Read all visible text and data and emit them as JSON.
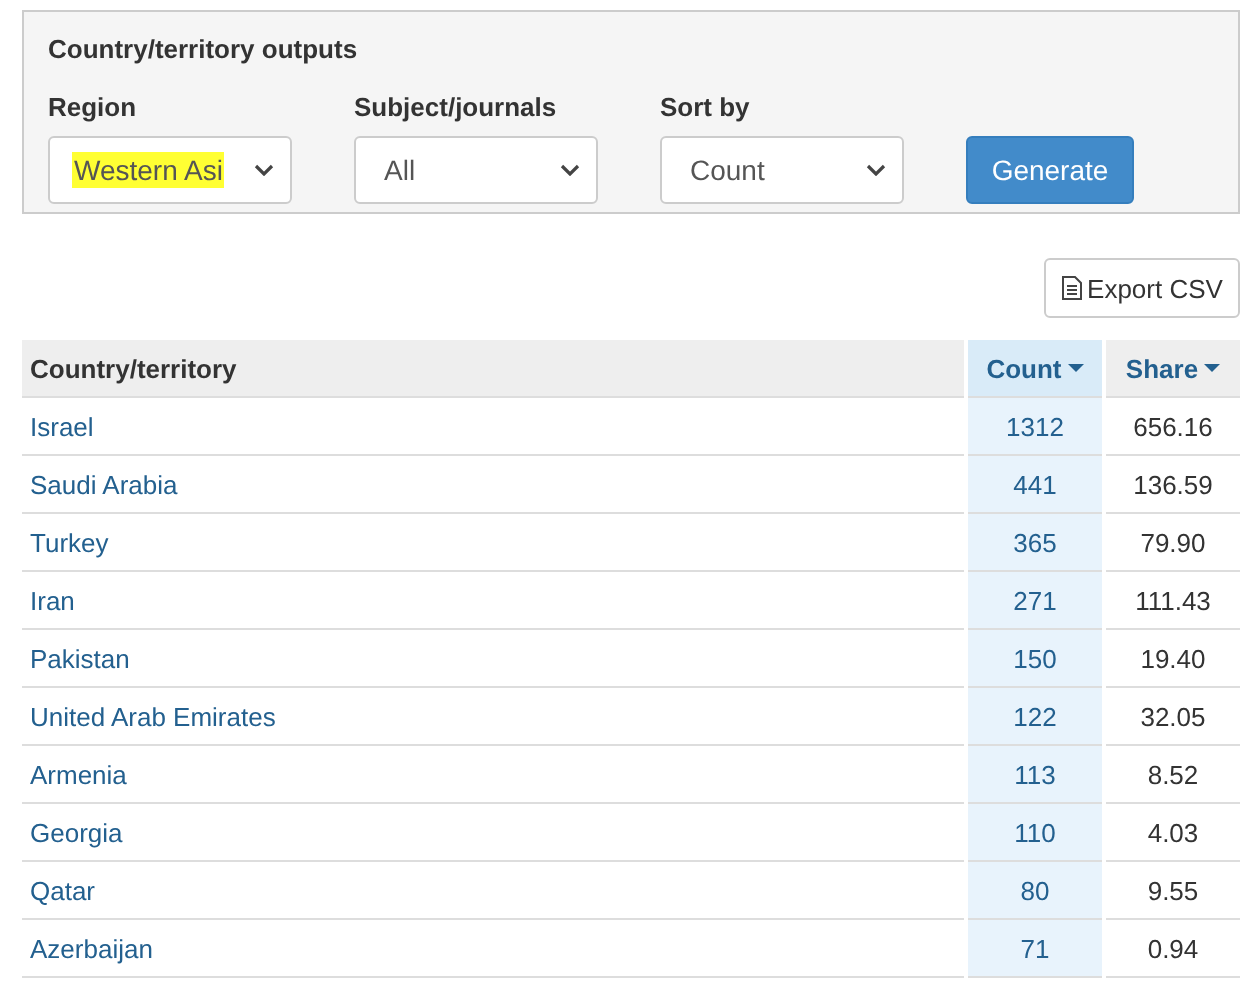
{
  "panel": {
    "title": "Country/territory outputs",
    "fields": [
      {
        "label": "Region",
        "value": "Western Asi",
        "highlighted": true
      },
      {
        "label": "Subject/journals",
        "value": "All",
        "highlighted": false
      },
      {
        "label": "Sort by",
        "value": "Count",
        "highlighted": false
      }
    ],
    "generate_button": "Generate"
  },
  "export_button": "Export CSV",
  "table": {
    "columns": [
      {
        "label": "Country/territory",
        "kind": "text"
      },
      {
        "label": "Count",
        "kind": "sort",
        "selected": true
      },
      {
        "label": "Share",
        "kind": "sort",
        "selected": false
      }
    ],
    "rows": [
      [
        "Israel",
        "1312",
        "656.16"
      ],
      [
        "Saudi Arabia",
        "441",
        "136.59"
      ],
      [
        "Turkey",
        "365",
        "79.90"
      ],
      [
        "Iran",
        "271",
        "111.43"
      ],
      [
        "Pakistan",
        "150",
        "19.40"
      ],
      [
        "United Arab Emirates",
        "122",
        "32.05"
      ],
      [
        "Armenia",
        "113",
        "8.52"
      ],
      [
        "Georgia",
        "110",
        "4.03"
      ],
      [
        "Qatar",
        "80",
        "9.55"
      ],
      [
        "Azerbaijan",
        "71",
        "0.94"
      ]
    ]
  }
}
